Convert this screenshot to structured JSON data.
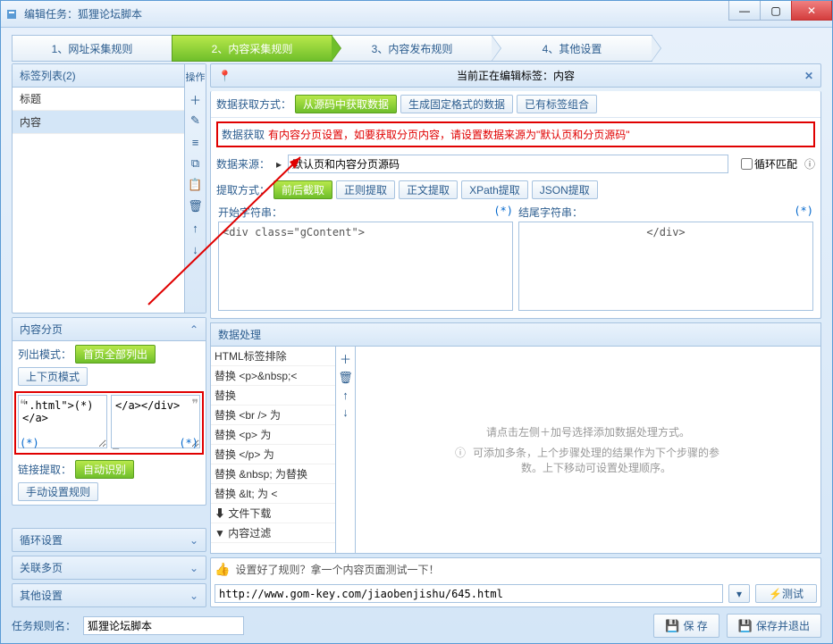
{
  "window": {
    "title": "编辑任务：狐狸论坛脚本"
  },
  "tabs": [
    "1、网址采集规则",
    "2、内容采集规则",
    "3、内容发布规则",
    "4、其他设置"
  ],
  "taglist": {
    "header": "标签列表(2)",
    "ops_header": "操作",
    "items": [
      "标题",
      "内容"
    ]
  },
  "paging": {
    "header": "内容分页",
    "list_mode_label": "列出模式：",
    "btn_all": "首页全部列出",
    "btn_prevnext": "上下页模式",
    "box1_text": "\".html\">(*)</a>",
    "box1_star": "(*)",
    "box2_text": "</a></div>",
    "box2_dash": "_",
    "box2_star": "(*)",
    "link_extract_label": "链接提取：",
    "btn_auto": "自动识别",
    "btn_manual": "手动设置规则"
  },
  "collapsed": {
    "loop": "循环设置",
    "multi": "关联多页",
    "other": "其他设置"
  },
  "editing": {
    "label_prefix": "当前正在编辑标签：",
    "label_value": "内容"
  },
  "fetch": {
    "method_label": "数据获取方式：",
    "btn_source": "从源码中获取数据",
    "btn_fixed": "生成固定格式的数据",
    "btn_combo": "已有标签组合",
    "data_fetch_label": "数据获取",
    "warning": "有内容分页设置，如要获取分页内容，请设置数据来源为\"默认页和分页源码\"",
    "source_label": "数据来源：",
    "source_value": "默认页和内容分页源码",
    "loop_match": "循环匹配",
    "extract_label": "提取方式：",
    "ext_btns": [
      "前后截取",
      "正则提取",
      "正文提取",
      "XPath提取",
      "JSON提取"
    ],
    "start_label": "开始字符串：",
    "end_label": "结尾字符串：",
    "start_value": "<div class=\"gContent\">",
    "end_value": "</div>",
    "star": "(*)"
  },
  "proc": {
    "header": "数据处理",
    "items": [
      "HTML标签排除",
      "替换 <p>&nbsp;<",
      "替换",
      "替换 <br /> 为",
      "替换 <p> 为",
      "替换 </p> 为",
      "替换 &nbsp; 为替换",
      "替换 &lt; 为 <",
      "文件下载",
      "内容过滤"
    ],
    "hint1": "请点击左侧＋加号选择添加数据处理方式。",
    "hint2": "可添加多条，上个步骤处理的结果作为下个步骤的参数。上下移动可设置处理顺序。"
  },
  "test": {
    "label": "设置好了规则？拿一个内容页面测试一下！",
    "url": "http://www.gom-key.com/jiaobenjishu/645.html",
    "btn": "测试"
  },
  "footer": {
    "rule_name_label": "任务规则名：",
    "rule_name_value": "狐狸论坛脚本",
    "save": "保 存",
    "save_exit": "保存并退出"
  }
}
